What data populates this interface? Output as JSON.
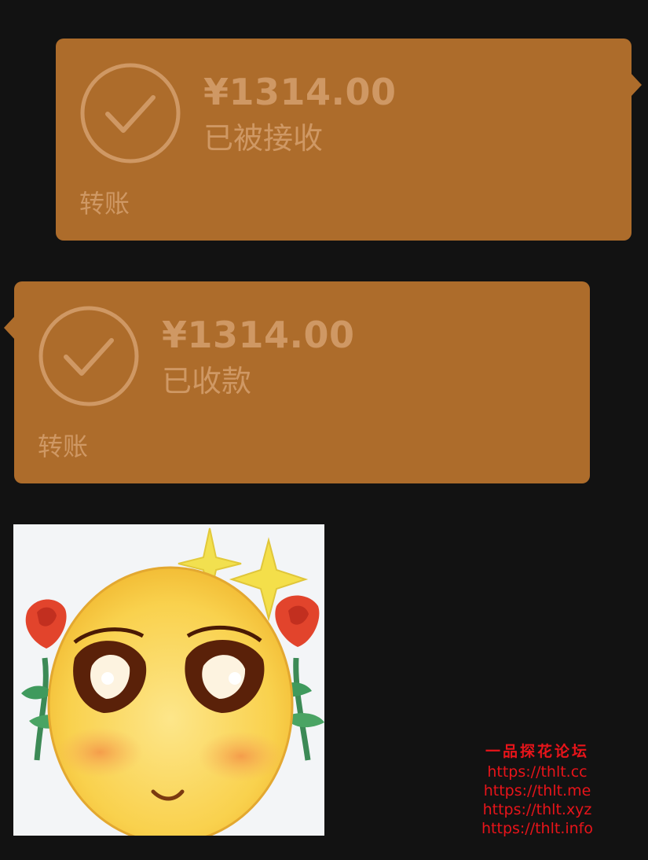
{
  "colors": {
    "background": "#121212",
    "card": "#ad6c2b",
    "card_text": "#cf9864",
    "watermark": "#e8141a"
  },
  "messages": [
    {
      "direction": "sent",
      "icon": "check-circle-icon",
      "amount": "¥1314.00",
      "status": "已被接收",
      "label": "转账"
    },
    {
      "direction": "received",
      "icon": "check-circle-icon",
      "amount": "¥1314.00",
      "status": "已收款",
      "label": "转账"
    }
  ],
  "sticker": {
    "icon": "sticker-emoji-with-roses"
  },
  "watermark": {
    "title": "一品探花论坛",
    "urls": [
      "https://thlt.cc",
      "https://thlt.me",
      "https://thlt.xyz",
      "https://thlt.info"
    ]
  }
}
